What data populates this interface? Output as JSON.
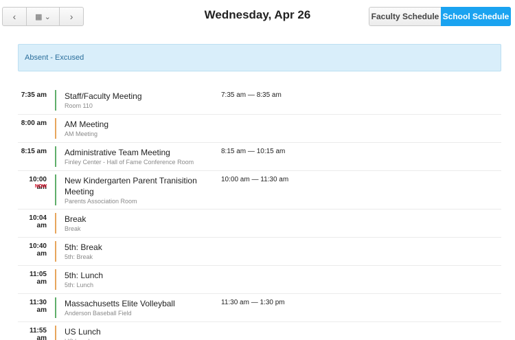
{
  "nav": {
    "prev": "‹",
    "calendar": "▦ ⌄",
    "next": "›"
  },
  "header": {
    "title": "Wednesday, Apr 26"
  },
  "schedule_toggle": {
    "faculty": "Faculty Schedule",
    "school": "School Schedule",
    "active": "school",
    "active_color": "#1aa3f0"
  },
  "alert": {
    "text": "Absent - Excused",
    "color": "#d9eefa"
  },
  "events": [
    {
      "time": "7:35 am",
      "title": "Staff/Faculty Meeting",
      "location": "Room 110",
      "range": "7:35 am — 8:35 am",
      "bar": "green",
      "now": ""
    },
    {
      "time": "8:00 am",
      "title": "AM Meeting",
      "location": "AM Meeting",
      "range": "",
      "bar": "orange",
      "now": ""
    },
    {
      "time": "8:15 am",
      "title": "Administrative Team Meeting",
      "location": "Finley Center - Hall of Fame Conference Room",
      "range": "8:15 am — 10:15 am",
      "bar": "green",
      "now": ""
    },
    {
      "time": "10:00 am",
      "title": "New Kindergarten Parent Tranisition Meeting",
      "location": "Parents Association Room",
      "range": "10:00 am — 11:30 am",
      "bar": "green",
      "now": "NOW"
    },
    {
      "time": "10:04 am",
      "title": "Break",
      "location": "Break",
      "range": "",
      "bar": "orange",
      "now": ""
    },
    {
      "time": "10:40 am",
      "title": "5th: Break",
      "location": "5th: Break",
      "range": "",
      "bar": "orange",
      "now": ""
    },
    {
      "time": "11:05 am",
      "title": "5th: Lunch",
      "location": "5th: Lunch",
      "range": "",
      "bar": "orange",
      "now": ""
    },
    {
      "time": "11:30 am",
      "title": "Massachusetts Elite Volleyball",
      "location": "Anderson Baseball Field",
      "range": "11:30 am — 1:30 pm",
      "bar": "green",
      "now": ""
    },
    {
      "time": "11:55 am",
      "title": "US Lunch",
      "location": "US Lunch",
      "range": "",
      "bar": "orange",
      "now": ""
    }
  ]
}
